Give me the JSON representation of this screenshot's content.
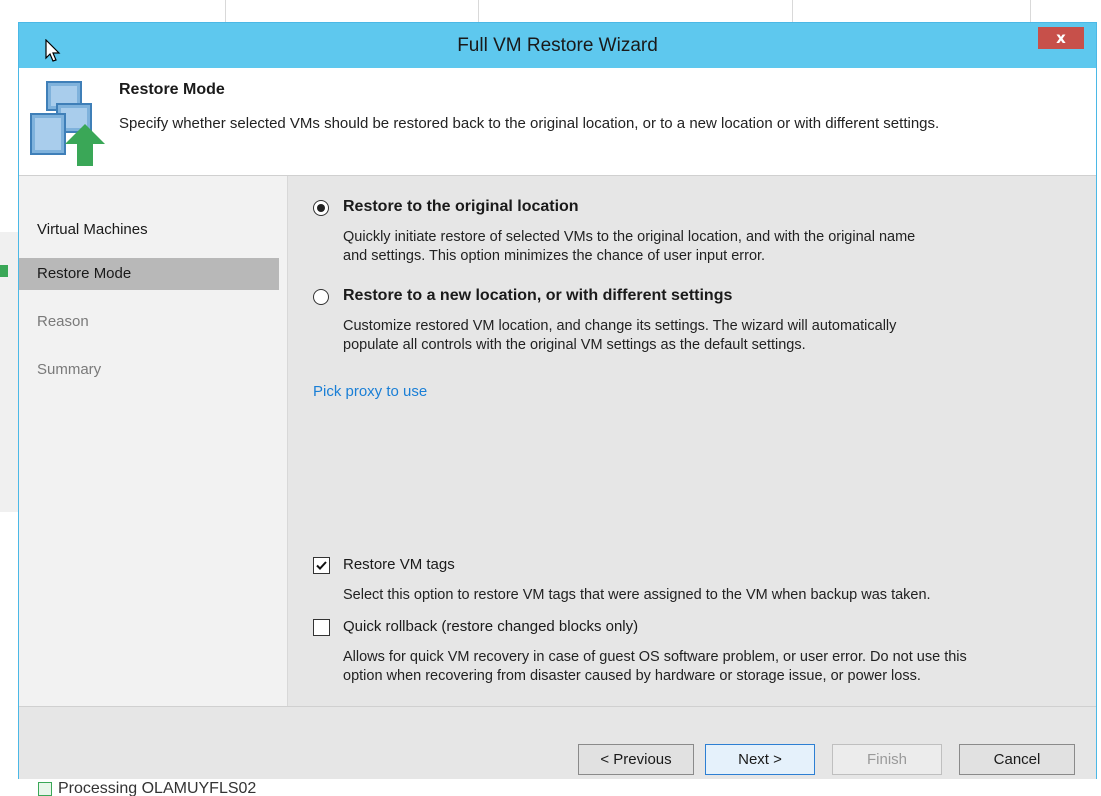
{
  "window": {
    "title": "Full VM Restore Wizard",
    "close_label": "x"
  },
  "header": {
    "title": "Restore Mode",
    "description": "Specify whether selected VMs should be restored back to the original location, or to a new location or with different settings."
  },
  "sidebar": {
    "items": [
      {
        "label": "Virtual Machines"
      },
      {
        "label": "Restore Mode"
      },
      {
        "label": "Reason"
      },
      {
        "label": "Summary"
      }
    ]
  },
  "options": [
    {
      "label": "Restore to the original location",
      "selected": true,
      "desc1": "Quickly initiate restore of selected VMs to the original location, and with the original name",
      "desc2": "and settings. This option minimizes the chance of user input error."
    },
    {
      "label": "Restore to a new location, or with different settings",
      "selected": false,
      "desc1": "Customize restored VM location, and change its settings. The wizard will automatically",
      "desc2": "populate all controls with the original VM settings as the default settings."
    }
  ],
  "proxy_link": "Pick proxy to use",
  "checks": [
    {
      "label": "Restore VM tags",
      "checked": true,
      "desc1": "Select this option to restore VM tags that were assigned to the VM when backup was taken."
    },
    {
      "label": "Quick rollback (restore changed blocks only)",
      "checked": false,
      "desc1": "Allows for quick VM recovery in case of guest OS software problem, or user error. Do not use this",
      "desc2": "option when recovering from disaster caused by hardware or storage issue, or power loss."
    }
  ],
  "buttons": {
    "previous": "< Previous",
    "next": "Next >",
    "finish": "Finish",
    "cancel": "Cancel"
  },
  "background": {
    "status_text": "Processing OLAMUYFLS02"
  },
  "colors": {
    "titlebar": "#5ec8ee",
    "link": "#1a7fd6",
    "close": "#c7504a",
    "accent_green": "#3aa757"
  }
}
